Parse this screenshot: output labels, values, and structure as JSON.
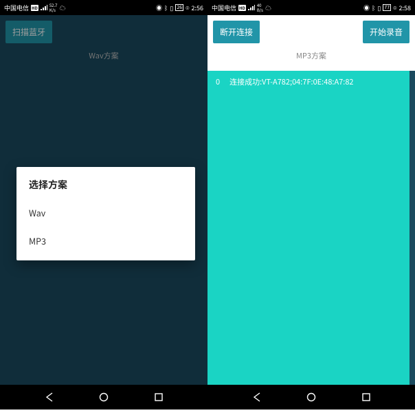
{
  "left": {
    "status": {
      "carrier": "中国电信",
      "net": "52.7",
      "unit": "K/s",
      "batt": "26",
      "time": "2:56"
    },
    "button": "扫描蓝牙",
    "plan_label": "Wav方案",
    "dialog": {
      "title": "选择方案",
      "items": [
        "Wav",
        "MP3"
      ]
    }
  },
  "right": {
    "status": {
      "carrier": "中国电信",
      "net": "40",
      "unit": "B/s",
      "batt": "77",
      "time": "2:58"
    },
    "button_left": "断开连接",
    "button_right": "开始录音",
    "plan_label": "MP3方案",
    "log": {
      "index": "0",
      "msg": "连接成功:VT-A782;04:7F:0E:48:A7:82"
    }
  }
}
